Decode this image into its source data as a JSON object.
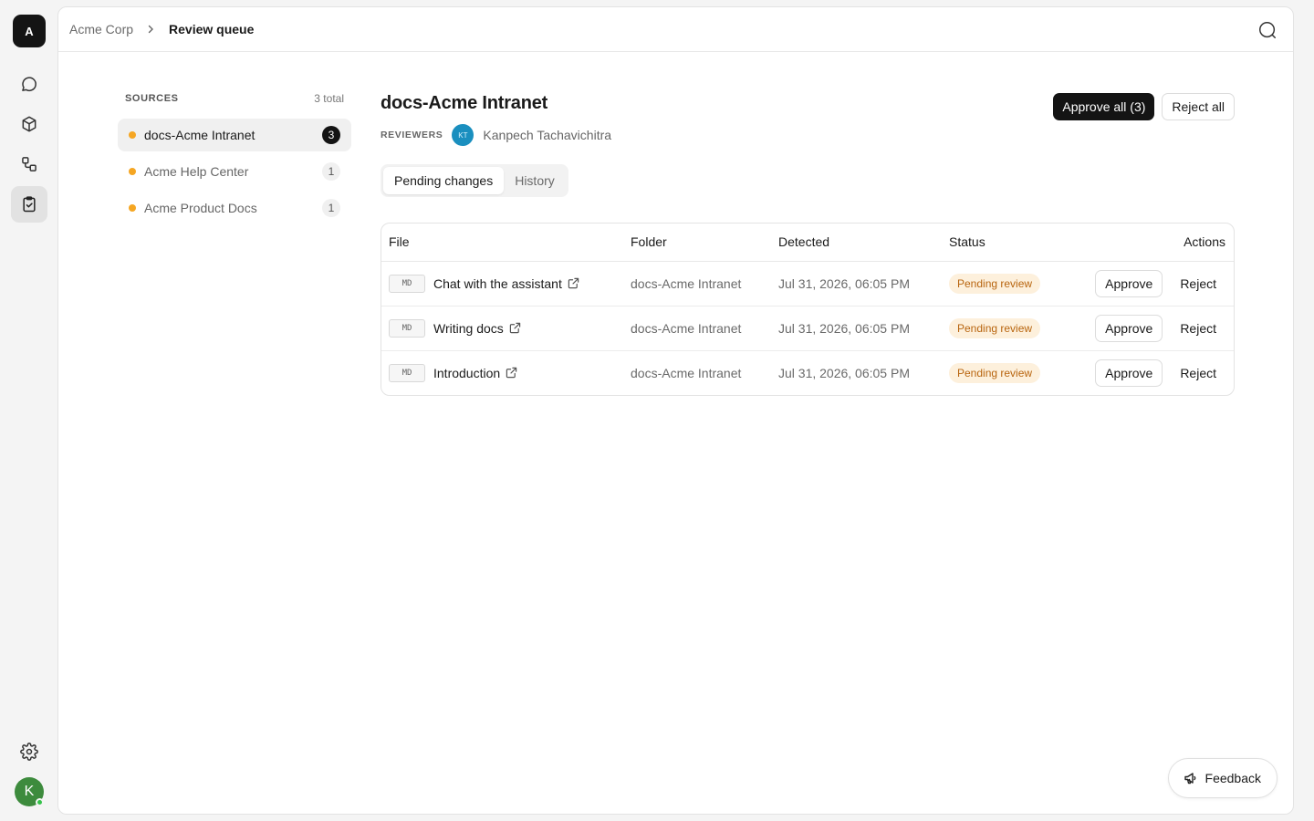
{
  "rail": {
    "org_initial": "A",
    "user_initial": "K",
    "items": [
      {
        "icon": "chat-icon"
      },
      {
        "icon": "cube-icon"
      },
      {
        "icon": "workflow-icon"
      },
      {
        "icon": "clipboard-check-icon",
        "active": true
      }
    ],
    "settings_icon": "gear-icon"
  },
  "breadcrumb": {
    "org": "Acme Corp",
    "page": "Review queue"
  },
  "sources": {
    "title": "SOURCES",
    "total": "3 total",
    "items": [
      {
        "label": "docs-Acme Intranet",
        "count": "3",
        "active": true
      },
      {
        "label": "Acme Help Center",
        "count": "1"
      },
      {
        "label": "Acme Product Docs",
        "count": "1"
      }
    ]
  },
  "detail": {
    "title": "docs-Acme Intranet",
    "reviewers_label": "REVIEWERS",
    "reviewer_initials": "KT",
    "reviewer_name": "Kanpech Tachavichitra",
    "approve_all": "Approve all (3)",
    "reject_all": "Reject all",
    "tabs": [
      "Pending changes",
      "History"
    ],
    "active_tab": 0
  },
  "table": {
    "columns": [
      "File",
      "Folder",
      "Detected",
      "Status",
      "Actions"
    ],
    "rows": [
      {
        "type": "MD",
        "file": "Chat with the assistant",
        "folder": "docs-Acme Intranet",
        "detected": "Jul 31, 2026, 06:05 PM",
        "status": "Pending review",
        "approve": "Approve",
        "reject": "Reject"
      },
      {
        "type": "MD",
        "file": "Writing docs",
        "folder": "docs-Acme Intranet",
        "detected": "Jul 31, 2026, 06:05 PM",
        "status": "Pending review",
        "approve": "Approve",
        "reject": "Reject"
      },
      {
        "type": "MD",
        "file": "Introduction",
        "folder": "docs-Acme Intranet",
        "detected": "Jul 31, 2026, 06:05 PM",
        "status": "Pending review",
        "approve": "Approve",
        "reject": "Reject"
      }
    ]
  },
  "feedback": {
    "label": "Feedback"
  },
  "colors": {
    "accent_dark": "#141414",
    "pending_bg": "#fdf0dc",
    "pending_text": "#b8650f",
    "source_dot": "#f5a623",
    "user_avatar": "#3d8b3d",
    "reviewer_avatar": "#1a8fbf"
  }
}
